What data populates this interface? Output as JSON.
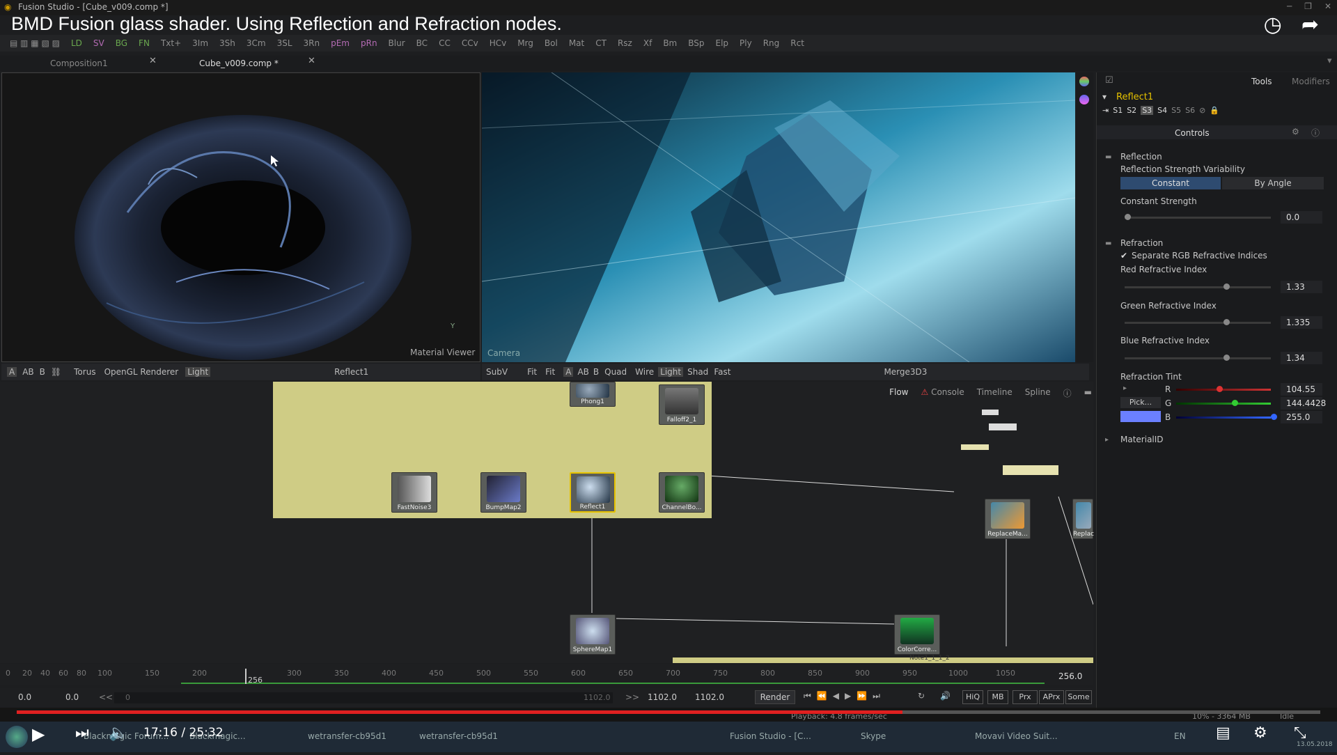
{
  "window": {
    "title": "Fusion Studio - [Cube_v009.comp *]"
  },
  "video": {
    "title": "BMD Fusion glass shader. Using Reflection and Refraction nodes.",
    "time": "17:16 / 25:32"
  },
  "toolbar": {
    "items": [
      "LD",
      "SV",
      "BG",
      "FN",
      "Txt+",
      "3Im",
      "3Sh",
      "3Cm",
      "3SL",
      "3Rn",
      "pEm",
      "pRn",
      "Blur",
      "BC",
      "CC",
      "CCv",
      "HCv",
      "Mrg",
      "Bol",
      "Mat",
      "CT",
      "Rsz",
      "Xf",
      "Bm",
      "BSp",
      "Elp",
      "Ply",
      "Rng",
      "Rct"
    ]
  },
  "tabs": [
    "Composition1",
    "Cube_v009.comp *"
  ],
  "viewer_left": {
    "label": "Material Viewer",
    "axis": "Y",
    "bar": [
      "A",
      "AB",
      "B",
      "Torus",
      "OpenGL Renderer",
      "Light",
      "Reflect1"
    ]
  },
  "viewer_right": {
    "label": "Camera",
    "bar": [
      "SubV",
      "Fit",
      "Fit",
      "A",
      "AB",
      "B",
      "Quad",
      "Wire",
      "Light",
      "Shad",
      "Fast",
      "Merge3D3"
    ]
  },
  "panel": {
    "tabs": [
      "Tools",
      "Modifiers"
    ],
    "node_name": "Reflect1",
    "slots": [
      "S1",
      "S2",
      "S3",
      "S4",
      "S5",
      "S6"
    ],
    "controls_header": "Controls",
    "reflection": {
      "section": "Reflection",
      "variability_label": "Reflection Strength Variability",
      "opt_constant": "Constant",
      "opt_by_angle": "By Angle",
      "const_label": "Constant Strength",
      "const_value": "0.0"
    },
    "refraction": {
      "section": "Refraction",
      "separate": "Separate RGB Refractive Indices",
      "red_label": "Red Refractive Index",
      "red_value": "1.33",
      "green_label": "Green Refractive Index",
      "green_value": "1.335",
      "blue_label": "Blue Refractive Index",
      "blue_value": "1.34",
      "tint_label": "Refraction Tint",
      "r_label": "R",
      "r_value": "104.55",
      "g_label": "G",
      "g_value": "144.4428",
      "b_label": "B",
      "b_value": "255.0",
      "pick": "Pick..."
    },
    "material_id": "MaterialID"
  },
  "flow": {
    "tabs": [
      "Flow",
      "Console",
      "Timeline",
      "Spline"
    ]
  },
  "nodes": {
    "phong": "Phong1",
    "falloff": "Falloff2_1",
    "fastnoise": "FastNoise3",
    "bumpmap": "BumpMap2",
    "reflect": "Reflect1",
    "channelbool": "ChannelBo...",
    "spheremap": "SphereMap1",
    "colorcorr": "ColorCorre...",
    "replacemat": "ReplaceMa...",
    "replac2": "Replac",
    "note": "Note1_1_1_2"
  },
  "timeline": {
    "ticks": [
      "0",
      "20",
      "40",
      "60",
      "80",
      "100",
      "150",
      "200",
      "256",
      "300",
      "350",
      "400",
      "450",
      "500",
      "550",
      "600",
      "650",
      "700",
      "750",
      "800",
      "850",
      "900",
      "950",
      "1000",
      "1050"
    ],
    "end": "256.0"
  },
  "transport": {
    "start": "0.0",
    "start2": "0.0",
    "rew": "<<",
    "cur": "0",
    "end_field": "1102.0",
    "fwd": ">>",
    "v1": "1102.0",
    "v2": "1102.0",
    "render": "Render",
    "hiq": "HiQ",
    "mb": "MB",
    "prx": "Prx",
    "aprx": "APrx",
    "some": "Some"
  },
  "status": {
    "playback": "Playback: 4.8 frames/sec",
    "mem": "10% - 3364 MB",
    "idle": "Idle"
  },
  "taskbar": {
    "items": [
      "Blackmagic Forum...",
      "Blackmagic...",
      "wetransfer-cb95d1",
      "wetransfer-cb95d1",
      "Fusion Studio - [C...",
      "Skype",
      "Movavi Video Suit..."
    ],
    "lang": "EN",
    "date": "13.05.2018"
  },
  "colors": {
    "accent": "#6688ff",
    "tint": "#6b80ff"
  }
}
